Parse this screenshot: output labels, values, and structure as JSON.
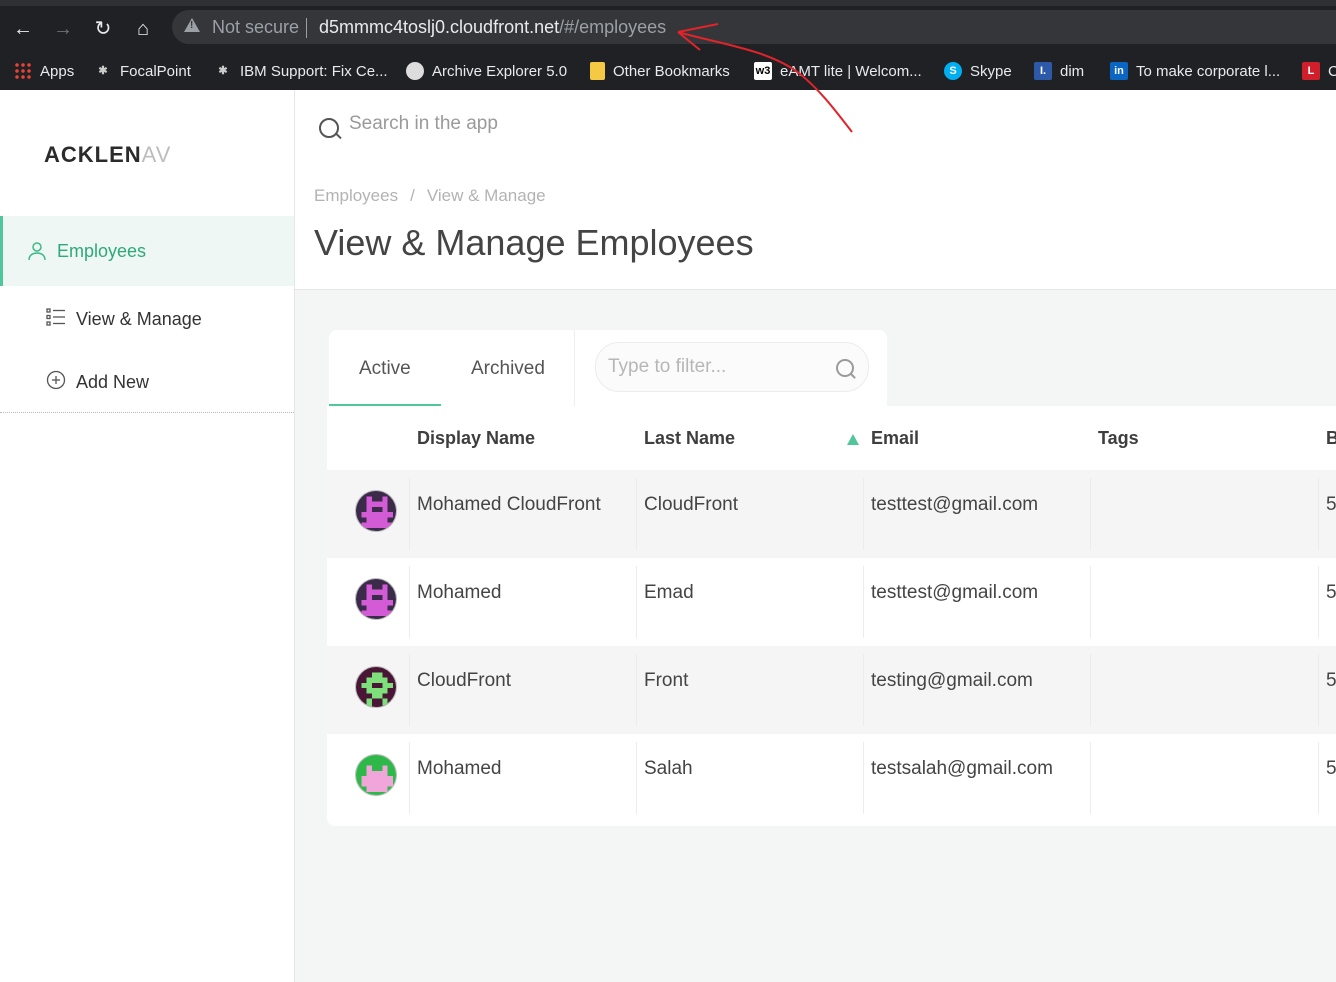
{
  "browser": {
    "not_secure": "Not secure",
    "url_host": "d5mmmc4toslj0.cloudfront.net",
    "url_path": "/#/employees",
    "bookmarks": [
      {
        "label": "Apps",
        "icon": "apps-grid-icon"
      },
      {
        "label": "FocalPoint",
        "icon": "focalpoint-icon"
      },
      {
        "label": "IBM Support: Fix Ce...",
        "icon": "ibm-icon"
      },
      {
        "label": "Archive Explorer 5.0",
        "icon": "archive-icon"
      },
      {
        "label": "Other Bookmarks",
        "icon": "folder-icon"
      },
      {
        "label": "eAMT lite | Welcom...",
        "icon": "w3-icon",
        "glyph": "w3"
      },
      {
        "label": "Skype",
        "icon": "skype-icon",
        "glyph": "S"
      },
      {
        "label": "dim",
        "icon": "i-icon",
        "glyph": "I."
      },
      {
        "label": "To make corporate l...",
        "icon": "linkedin-icon",
        "glyph": "in"
      },
      {
        "label": "C",
        "icon": "l-icon",
        "glyph": "L"
      }
    ]
  },
  "app": {
    "logo": "ACKLEN",
    "logo_faded": "AV",
    "search_placeholder": "Search in the app"
  },
  "sidebar": {
    "section": "Employees",
    "items": [
      {
        "label": "View & Manage",
        "icon": "list-icon"
      },
      {
        "label": "Add New",
        "icon": "plus-circle-icon"
      }
    ]
  },
  "header": {
    "breadcrumb": [
      "Employees",
      "View & Manage"
    ],
    "title": "View & Manage Employees"
  },
  "tabs": [
    "Active",
    "Archived"
  ],
  "filter_placeholder": "Type to filter...",
  "table": {
    "columns": [
      "Display Name",
      "Last Name",
      "Email",
      "Tags",
      "B"
    ],
    "rows": [
      {
        "display_name": "Mohamed CloudFront",
        "last_name": "CloudFront",
        "email": "testtest@gmail.com",
        "tags": "",
        "b": "5"
      },
      {
        "display_name": "Mohamed",
        "last_name": "Emad",
        "email": "testtest@gmail.com",
        "tags": "",
        "b": "5"
      },
      {
        "display_name": "CloudFront",
        "last_name": "Front",
        "email": "testing@gmail.com",
        "tags": "",
        "b": "5"
      },
      {
        "display_name": "Mohamed",
        "last_name": "Salah",
        "email": "testsalah@gmail.com",
        "tags": "",
        "b": "5"
      }
    ]
  },
  "colors": {
    "accent": "#4fc79a",
    "annotation": "#e0242a"
  }
}
